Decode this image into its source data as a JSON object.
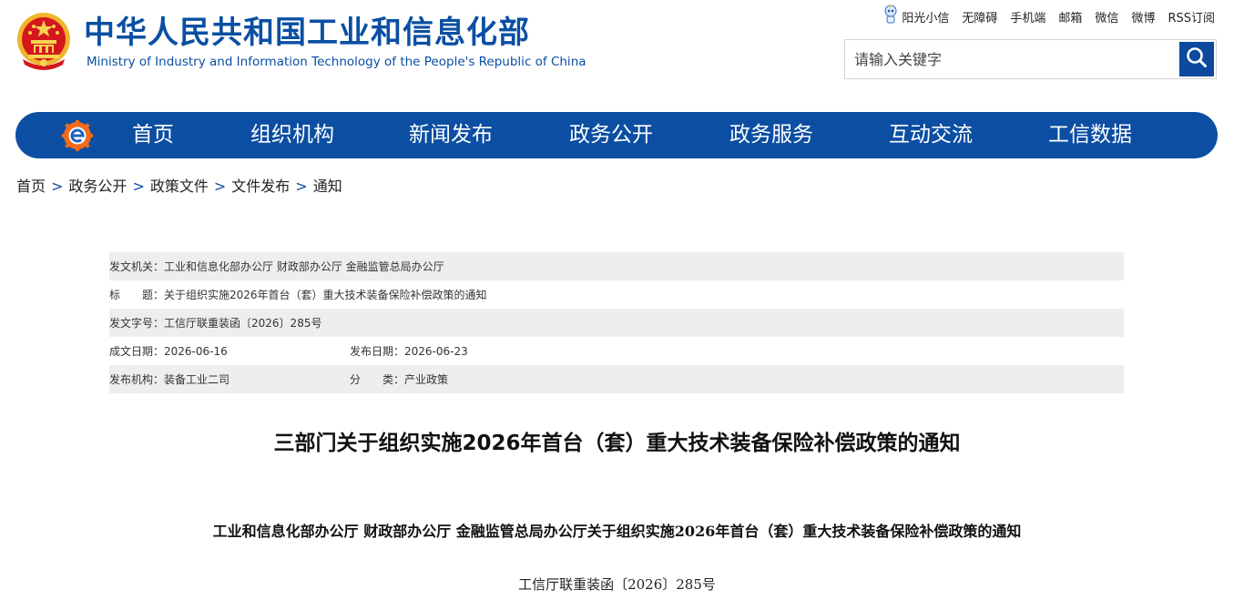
{
  "header": {
    "title_cn": "中华人民共和国工业和信息化部",
    "title_en": "Ministry of Industry and Information Technology of the People's Republic of China",
    "emblem_icon": "national-emblem-icon",
    "top_links": [
      "阳光小信",
      "无障碍",
      "手机端",
      "邮箱",
      "微信",
      "微博",
      "RSS订阅"
    ],
    "search": {
      "placeholder": "请输入关键字",
      "value": ""
    }
  },
  "nav": {
    "logo_icon": "ministry-logo-icon",
    "items": [
      "首页",
      "组织机构",
      "新闻发布",
      "政务公开",
      "政务服务",
      "互动交流",
      "工信数据"
    ]
  },
  "breadcrumb": [
    "首页",
    "政务公开",
    "政策文件",
    "文件发布",
    "通知"
  ],
  "info": {
    "issuer_label": "发文机关：",
    "issuer": "工业和信息化部办公厅 财政部办公厅 金融监管总局办公厅",
    "title_label": "标　　题：",
    "title": "关于组织实施2026年首台（套）重大技术装备保险补偿政策的通知",
    "doc_no_label": "发文字号：",
    "doc_no": "工信厅联重装函〔2026〕285号",
    "written_label": "成文日期：",
    "written_date": "2026-06-16",
    "published_label": "发布日期：",
    "published_date": "2026-06-23",
    "dept_label": "发布机构：",
    "dept": "装备工业二司",
    "category_label": "分　　类：",
    "category": "产业政策"
  },
  "article": {
    "title": "三部门关于组织实施2026年首台（套）重大技术装备保险补偿政策的通知",
    "subtitle": "工业和信息化部办公厅  财政部办公厅  金融监管总局办公厅关于组织实施2026年首台（套）重大技术装备保险补偿政策的通知",
    "doc_number": "工信厅联重装函〔2026〕285号"
  },
  "colors": {
    "brand_blue": "#0c4ea2",
    "emblem_red": "#d5161d",
    "emblem_gold": "#f3c33a"
  }
}
